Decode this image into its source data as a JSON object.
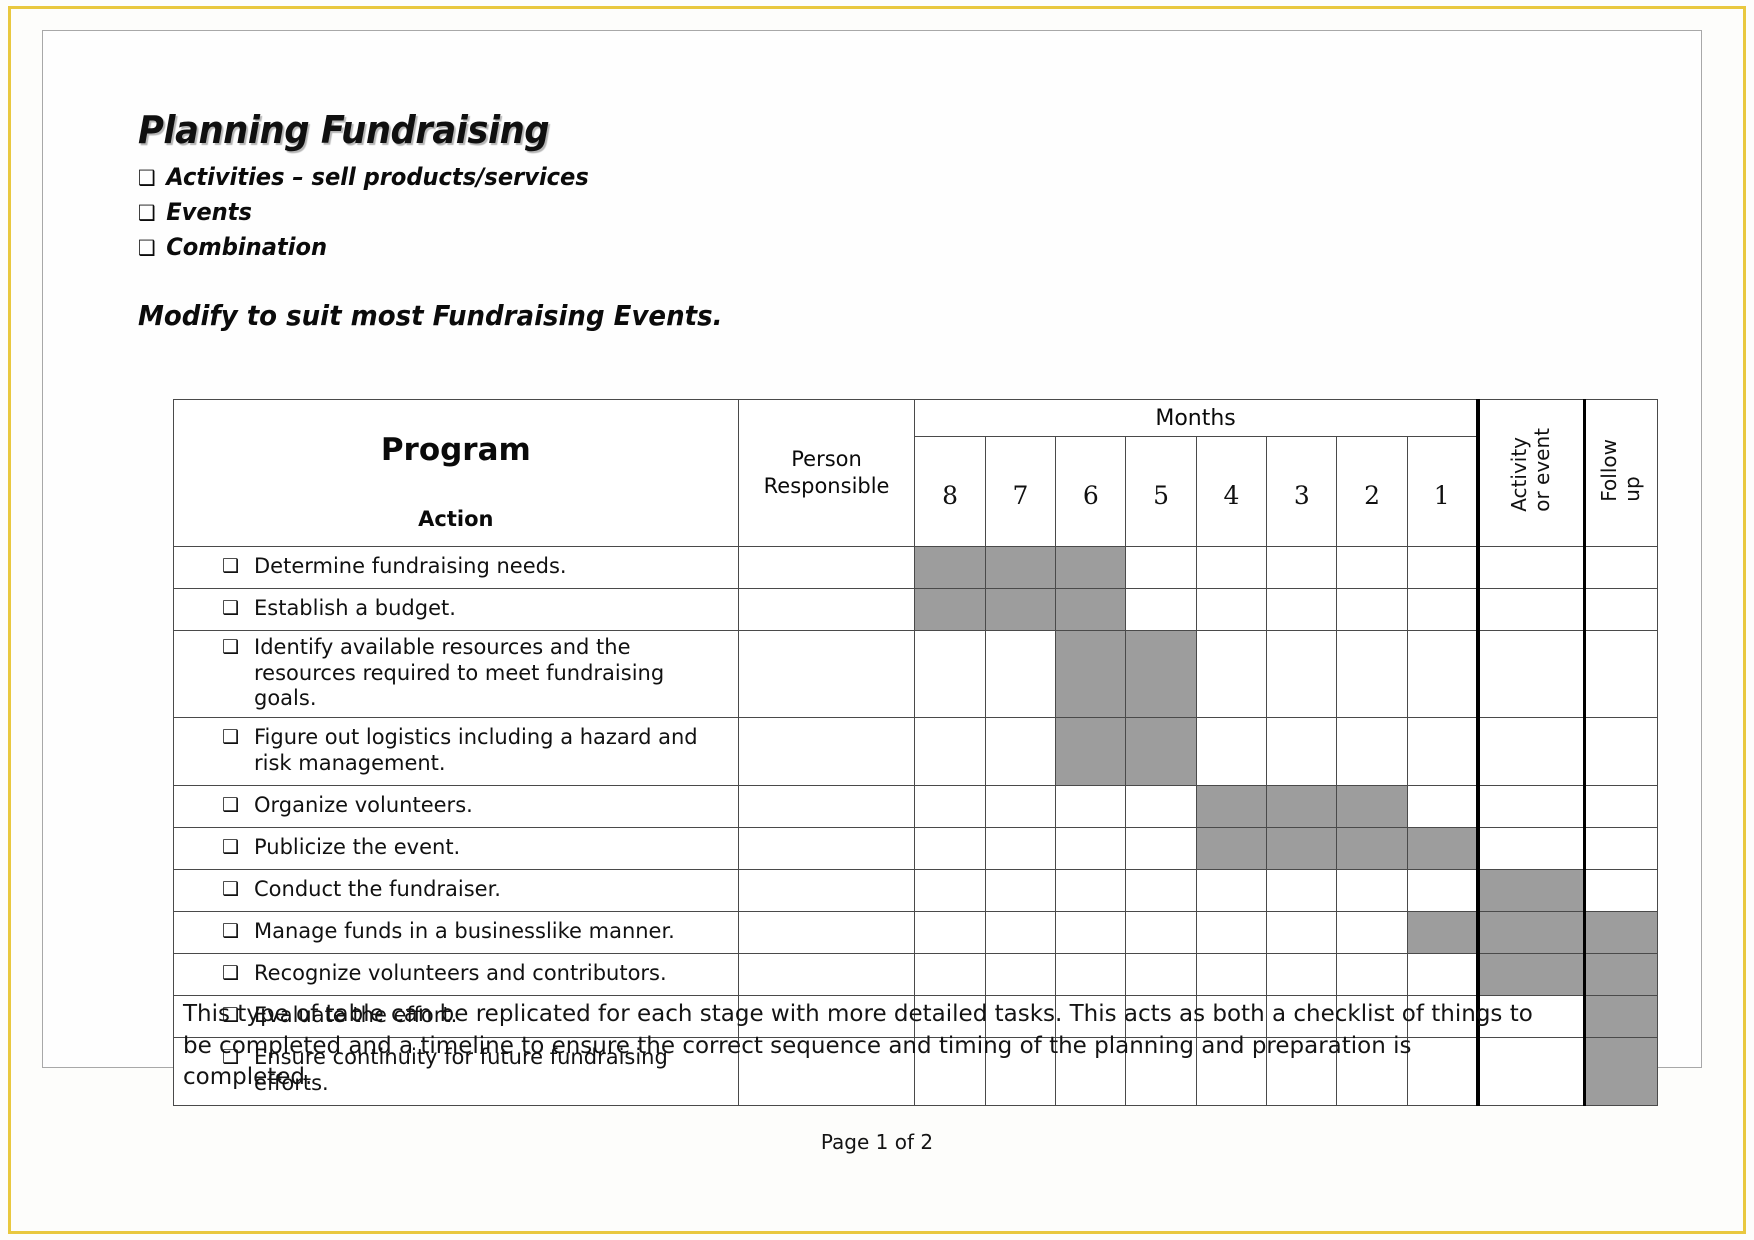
{
  "slide": {
    "title": "Planning Fundraising",
    "bullets": [
      {
        "marker": "❑",
        "text": "Activities – sell products/services"
      },
      {
        "marker": "❑",
        "text": "Events"
      },
      {
        "marker": "❑",
        "text": "Combination"
      }
    ],
    "subtitle": "Modify to suit most Fundraising Events.",
    "caption": "This type of table can be replicated for each stage with more detailed tasks.  This acts as both a checklist of things to be completed and a timeline to ensure the correct sequence and timing of the planning and preparation is completed.",
    "page_label": "Page 1 of 2",
    "watermark": ""
  },
  "table": {
    "headers": {
      "program": "Program",
      "action": "Action",
      "person_responsible": "Person\nResponsible",
      "person_responsible_line1": "Person",
      "person_responsible_line2": "Responsible",
      "months_group": "Months",
      "month_numbers": [
        "8",
        "7",
        "6",
        "5",
        "4",
        "3",
        "2",
        "1"
      ],
      "activity_line1": "Activity",
      "activity_line2": "or event",
      "follow_line1": "Follow",
      "follow_line2": "up"
    },
    "row_marker": "❑",
    "rows": [
      {
        "task": "Determine fundraising needs.",
        "lines": 1,
        "months": [
          true,
          true,
          true,
          false,
          false,
          false,
          false,
          false
        ],
        "activity": false,
        "follow_up": false
      },
      {
        "task": "Establish a budget.",
        "lines": 1,
        "months": [
          true,
          true,
          true,
          false,
          false,
          false,
          false,
          false
        ],
        "activity": false,
        "follow_up": false
      },
      {
        "task": "Identify available resources and the resources required to meet fundraising goals.",
        "lines": 2,
        "months": [
          false,
          false,
          true,
          true,
          false,
          false,
          false,
          false
        ],
        "activity": false,
        "follow_up": false
      },
      {
        "task": "Figure out logistics including a hazard and risk management.",
        "lines": 2,
        "months": [
          false,
          false,
          true,
          true,
          false,
          false,
          false,
          false
        ],
        "activity": false,
        "follow_up": false
      },
      {
        "task": "Organize volunteers.",
        "lines": 1,
        "months": [
          false,
          false,
          false,
          false,
          true,
          true,
          true,
          false
        ],
        "activity": false,
        "follow_up": false
      },
      {
        "task": "Publicize the event.",
        "lines": 1,
        "months": [
          false,
          false,
          false,
          false,
          true,
          true,
          true,
          true
        ],
        "activity": false,
        "follow_up": false
      },
      {
        "task": "Conduct the fundraiser.",
        "lines": 1,
        "months": [
          false,
          false,
          false,
          false,
          false,
          false,
          false,
          false
        ],
        "activity": true,
        "follow_up": false
      },
      {
        "task": "Manage funds in a businesslike manner.",
        "lines": 1,
        "months": [
          false,
          false,
          false,
          false,
          false,
          false,
          false,
          true
        ],
        "activity": true,
        "follow_up": true
      },
      {
        "task": "Recognize volunteers and contributors.",
        "lines": 1,
        "months": [
          false,
          false,
          false,
          false,
          false,
          false,
          false,
          false
        ],
        "activity": true,
        "follow_up": true
      },
      {
        "task": "Evaluate the effort.",
        "lines": 1,
        "months": [
          false,
          false,
          false,
          false,
          false,
          false,
          false,
          false
        ],
        "activity": false,
        "follow_up": true
      },
      {
        "task": "Ensure continuity for future fundraising efforts.",
        "lines": 2,
        "months": [
          false,
          false,
          false,
          false,
          false,
          false,
          false,
          false
        ],
        "activity": false,
        "follow_up": true
      }
    ]
  },
  "colors": {
    "page_border": "#e9c83f",
    "shaded_cell": "#9d9d9d",
    "grid_line": "#4a4a4a",
    "heavy_line": "#000000",
    "text": "#111111"
  }
}
